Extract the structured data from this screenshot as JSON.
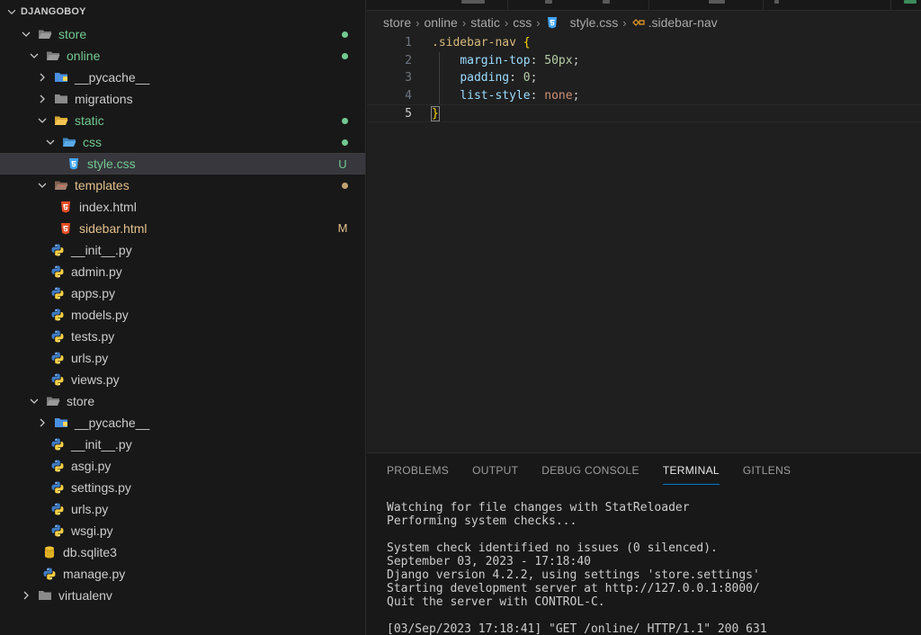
{
  "explorer": {
    "title": "DJANGOBOY",
    "items": [
      {
        "depth": 0,
        "kind": "folder",
        "open": true,
        "name": "store",
        "icon": "folder-open-icon",
        "color": "green",
        "dot": "#73c991"
      },
      {
        "depth": 1,
        "kind": "folder",
        "open": true,
        "name": "online",
        "icon": "folder-open-icon",
        "color": "green",
        "dot": "#73c991"
      },
      {
        "depth": 2,
        "kind": "folder",
        "open": false,
        "name": "__pycache__",
        "icon": "folder-python-icon"
      },
      {
        "depth": 2,
        "kind": "folder",
        "open": false,
        "name": "migrations",
        "icon": "folder-icon"
      },
      {
        "depth": 2,
        "kind": "folder",
        "open": true,
        "name": "static",
        "icon": "folder-open-yellow-icon",
        "color": "green",
        "dot": "#73c991"
      },
      {
        "depth": 3,
        "kind": "folder",
        "open": true,
        "name": "css",
        "icon": "folder-css-icon",
        "color": "green",
        "dot": "#73c991"
      },
      {
        "depth": 4,
        "kind": "file",
        "name": "style.css",
        "icon": "css-file-icon",
        "color": "green",
        "badge": "U",
        "selected": true
      },
      {
        "depth": 2,
        "kind": "folder",
        "open": true,
        "name": "templates",
        "icon": "folder-templates-icon",
        "color": "yellow",
        "dot": "#c0a070"
      },
      {
        "depth": 3,
        "kind": "file",
        "name": "index.html",
        "icon": "html-file-icon"
      },
      {
        "depth": 3,
        "kind": "file",
        "name": "sidebar.html",
        "icon": "html-file-icon",
        "color": "yellow",
        "badge": "M"
      },
      {
        "depth": 2,
        "kind": "file",
        "name": "__init__.py",
        "icon": "python-file-icon"
      },
      {
        "depth": 2,
        "kind": "file",
        "name": "admin.py",
        "icon": "python-file-icon"
      },
      {
        "depth": 2,
        "kind": "file",
        "name": "apps.py",
        "icon": "python-file-icon"
      },
      {
        "depth": 2,
        "kind": "file",
        "name": "models.py",
        "icon": "python-file-icon"
      },
      {
        "depth": 2,
        "kind": "file",
        "name": "tests.py",
        "icon": "python-file-icon"
      },
      {
        "depth": 2,
        "kind": "file",
        "name": "urls.py",
        "icon": "python-file-icon"
      },
      {
        "depth": 2,
        "kind": "file",
        "name": "views.py",
        "icon": "python-file-icon"
      },
      {
        "depth": 1,
        "kind": "folder",
        "open": true,
        "name": "store",
        "icon": "folder-open-icon"
      },
      {
        "depth": 2,
        "kind": "folder",
        "open": false,
        "name": "__pycache__",
        "icon": "folder-python-icon"
      },
      {
        "depth": 2,
        "kind": "file",
        "name": "__init__.py",
        "icon": "python-file-icon"
      },
      {
        "depth": 2,
        "kind": "file",
        "name": "asgi.py",
        "icon": "python-file-icon"
      },
      {
        "depth": 2,
        "kind": "file",
        "name": "settings.py",
        "icon": "python-file-icon"
      },
      {
        "depth": 2,
        "kind": "file",
        "name": "urls.py",
        "icon": "python-file-icon"
      },
      {
        "depth": 2,
        "kind": "file",
        "name": "wsgi.py",
        "icon": "python-file-icon"
      },
      {
        "depth": 1,
        "kind": "file",
        "name": "db.sqlite3",
        "icon": "database-icon"
      },
      {
        "depth": 1,
        "kind": "file",
        "name": "manage.py",
        "icon": "python-file-icon"
      },
      {
        "depth": 0,
        "kind": "folder",
        "open": false,
        "name": "virtualenv",
        "icon": "folder-icon"
      }
    ]
  },
  "breadcrumbs": {
    "parts": [
      "store",
      "online",
      "static",
      "css"
    ],
    "file": "style.css",
    "symbol": ".sidebar-nav"
  },
  "code": {
    "lines": [
      {
        "n": "1",
        "tokens": [
          {
            "t": ".sidebar-nav",
            "c": "sel"
          },
          {
            "t": " ",
            "c": "punc"
          },
          {
            "t": "{",
            "c": "brace"
          }
        ]
      },
      {
        "n": "2",
        "tokens": [
          {
            "t": "    ",
            "c": "punc"
          },
          {
            "t": "margin-top",
            "c": "prop"
          },
          {
            "t": ": ",
            "c": "punc"
          },
          {
            "t": "50px",
            "c": "num"
          },
          {
            "t": ";",
            "c": "punc"
          }
        ]
      },
      {
        "n": "3",
        "tokens": [
          {
            "t": "    ",
            "c": "punc"
          },
          {
            "t": "padding",
            "c": "prop"
          },
          {
            "t": ": ",
            "c": "punc"
          },
          {
            "t": "0",
            "c": "num"
          },
          {
            "t": ";",
            "c": "punc"
          }
        ]
      },
      {
        "n": "4",
        "tokens": [
          {
            "t": "    ",
            "c": "punc"
          },
          {
            "t": "list-style",
            "c": "prop"
          },
          {
            "t": ": ",
            "c": "punc"
          },
          {
            "t": "none",
            "c": "val"
          },
          {
            "t": ";",
            "c": "punc"
          }
        ]
      },
      {
        "n": "5",
        "tokens": [
          {
            "t": "}",
            "c": "brace"
          }
        ],
        "current": true
      }
    ]
  },
  "panel": {
    "tabs": [
      {
        "label": "PROBLEMS"
      },
      {
        "label": "OUTPUT"
      },
      {
        "label": "DEBUG CONSOLE"
      },
      {
        "label": "TERMINAL",
        "active": true
      },
      {
        "label": "GITLENS"
      }
    ],
    "terminal_lines": [
      "Watching for file changes with StatReloader",
      "Performing system checks...",
      "",
      "System check identified no issues (0 silenced).",
      "September 03, 2023 - 17:18:40",
      "Django version 4.2.2, using settings 'store.settings'",
      "Starting development server at http://127.0.0.1:8000/",
      "Quit the server with CONTROL-C.",
      "",
      "[03/Sep/2023 17:18:41] \"GET /online/ HTTP/1.1\" 200 631"
    ]
  },
  "colors": {
    "green": "#73c991",
    "yellow": "#e2c08d",
    "accent": "#0078d4"
  }
}
